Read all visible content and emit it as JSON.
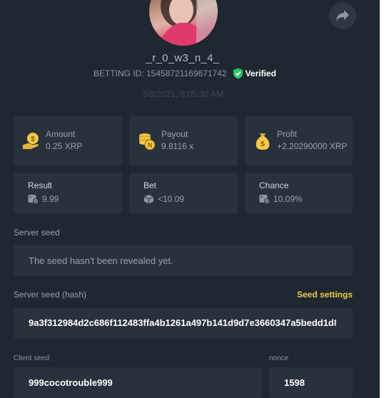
{
  "profile": {
    "username": "_r_0_w3_n_4_",
    "betting_id": "BETTING ID: 15458721169671742",
    "verified_label": "Verified",
    "timestamp": "3/8/2021, 8:05:30 AM"
  },
  "stats": [
    {
      "label": "Amount",
      "value": "0.25 XRP",
      "icon": "money-bag-hand-icon"
    },
    {
      "label": "Payout",
      "value": "9.8116 x",
      "icon": "coin-stack-icon"
    },
    {
      "label": "Profit",
      "value": "+2.20290000 XRP",
      "icon": "money-bag-icon"
    }
  ],
  "dice": [
    {
      "label": "Result",
      "value": "9.99"
    },
    {
      "label": "Bet",
      "value": "<10.09"
    },
    {
      "label": "Chance",
      "value": "10.09%"
    }
  ],
  "server_seed": {
    "label": "Server seed",
    "value": "The seed hasn't been revealed yet."
  },
  "server_seed_hash": {
    "label": "Server seed (hash)",
    "value": "9a3f312984d2c686f112483ffa4b1261a497b141d9d7e3660347a5bedd1d8",
    "settings_link": "Seed settings"
  },
  "client_seed": {
    "label": "Client seed",
    "value": "999cocotrouble999"
  },
  "nonce": {
    "label": "nonce",
    "value": "1598"
  },
  "colors": {
    "background": "#1f2731",
    "card": "#28313c",
    "accent_gold": "#f2c94c",
    "verified_green": "#2ec464"
  }
}
